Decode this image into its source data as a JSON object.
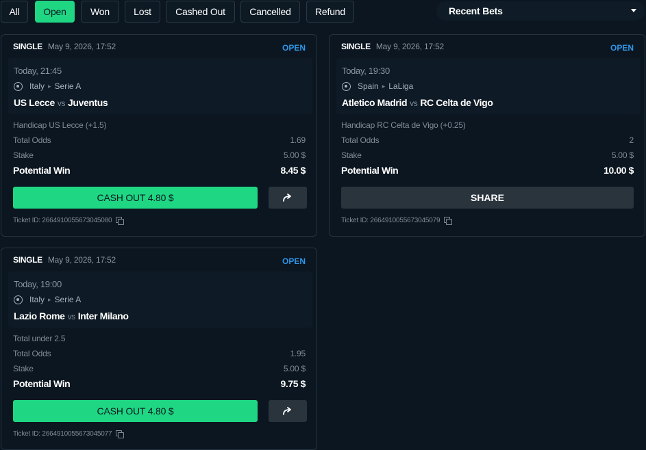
{
  "filters": {
    "all": "All",
    "open": "Open",
    "won": "Won",
    "lost": "Lost",
    "cashed_out": "Cashed Out",
    "cancelled": "Cancelled",
    "refund": "Refund",
    "active": "Open"
  },
  "recent_select": {
    "value": "Recent Bets"
  },
  "labels": {
    "total_odds": "Total Odds",
    "stake": "Stake",
    "potential_win": "Potential Win",
    "share": "SHARE"
  },
  "bets": [
    {
      "type": "SINGLE",
      "placed": "May 9, 2026, 17:52",
      "status": "OPEN",
      "time": "Today, 21:45",
      "country": "Italy",
      "league": "Serie A",
      "home": "US Lecce",
      "vs": "vs",
      "away": "Juventus",
      "market": "Handicap US Lecce (+1.5)",
      "total_odds": "1.69",
      "stake": "5.00 $",
      "potential_win": "8.45 $",
      "cashout_label": "CASH OUT 4.80 $",
      "ticket": "Ticket ID: 2664910055673045080"
    },
    {
      "type": "SINGLE",
      "placed": "May 9, 2026, 17:52",
      "status": "OPEN",
      "time": "Today, 19:30",
      "country": "Spain",
      "league": "LaLiga",
      "home": "Atletico Madrid",
      "vs": "vs",
      "away": "RC Celta de Vigo",
      "market": "Handicap RC Celta de Vigo (+0.25)",
      "total_odds": "2",
      "stake": "5.00 $",
      "potential_win": "10.00 $",
      "ticket": "Ticket ID: 2664910055673045079"
    },
    {
      "type": "SINGLE",
      "placed": "May 9, 2026, 17:52",
      "status": "OPEN",
      "time": "Today, 19:00",
      "country": "Italy",
      "league": "Serie A",
      "home": "Lazio Rome",
      "vs": "vs",
      "away": "Inter Milano",
      "market": "Total under 2.5",
      "total_odds": "1.95",
      "stake": "5.00 $",
      "potential_win": "9.75 $",
      "cashout_label": "CASH OUT 4.80 $",
      "ticket": "Ticket ID: 2664910055673045077"
    }
  ],
  "colors": {
    "background": "#0b1620",
    "accent": "#1fd783",
    "status_open": "#2f96e8"
  }
}
